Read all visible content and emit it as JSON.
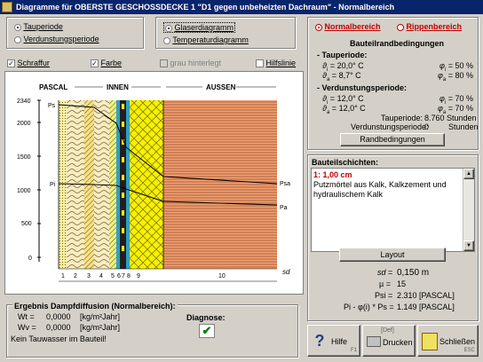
{
  "window": {
    "title": "Diagramme für OBERSTE GESCHOSSDECKE 1 \"D1 gegen unbeheizten Dachraum\" - Normalbereich"
  },
  "options": {
    "period_radio": [
      {
        "label": "Tauperiode",
        "checked": true
      },
      {
        "label": "Verdunstungsperiode",
        "checked": false
      }
    ],
    "diagram_radio": [
      {
        "label": "Glaserdiagramm",
        "checked": true
      },
      {
        "label": "Temperaturdiagramm",
        "checked": false
      }
    ],
    "checkboxes": [
      {
        "label": "Schraffur",
        "checked": true,
        "enabled": true
      },
      {
        "label": "Farbe",
        "checked": true,
        "enabled": true
      },
      {
        "label": "grau hinterlegt",
        "checked": false,
        "enabled": false
      },
      {
        "label": "Hilfslinie",
        "checked": false,
        "enabled": true
      }
    ]
  },
  "diagram": {
    "y_unit": "PASCAL",
    "y_ticks": [
      "2340",
      "2000",
      "1500",
      "1000",
      "500",
      "0"
    ],
    "inside_label": "INNEN",
    "outside_label": "AUSSEN",
    "x_label": "sd",
    "layer_numbers": [
      "1",
      "2",
      "3",
      "4",
      "5",
      "6",
      "7",
      "8",
      "9",
      "10"
    ],
    "curve_labels": {
      "ps_left": "Ps",
      "pi_left": "Pi",
      "psa_right": "Psa",
      "pa_right": "Pa"
    }
  },
  "right_top": {
    "mode_radio": [
      {
        "label": "Normalbereich",
        "checked": true
      },
      {
        "label": "Rippenbereich",
        "checked": false
      }
    ],
    "heading": "Bauteilrandbedingungen",
    "tau_heading": "- Tauperiode:",
    "tau": {
      "ti": "20,0° C",
      "ta": "8,7° C",
      "phi_i": "50 %",
      "phi_a": "80 %"
    },
    "verd_heading": "- Verdunstungsperiode:",
    "verd": {
      "ti": "12,0° C",
      "ta": "12,0° C",
      "phi_i": "70 %",
      "phi_a": "70 %"
    },
    "tauperiode_label": "Tauperiode:",
    "tauperiode_value": "8.760 Stunden",
    "verd_label": "Verdunstungsperiode:",
    "verd_value": "0",
    "verd_unit": "Stunden",
    "rand_button": "Randbedingungen"
  },
  "layers": {
    "heading": "Bauteilschichten:",
    "selected_title": "1: 1,00 cm",
    "selected_desc": "Putzmörtel aus Kalk, Kalkzement und hydraulischem Kalk",
    "layout_button": "Layout",
    "sd_label": "sd",
    "sd_value": "0,150 m",
    "mu_label": "µ",
    "mu_value": "15",
    "psi_label": "Psi",
    "psi_value": "2.310 [PASCAL]",
    "formula_label": "Pi - φ(i) * Ps",
    "formula_value": "1.149 [PASCAL]"
  },
  "result": {
    "heading": "Ergebnis Dampfdiffusion (Normalbereich):",
    "wt_label": "Wt",
    "wt_value": "0,0000",
    "wt_unit": "[kg/m²Jahr]",
    "wv_label": "Wv",
    "wv_value": "0,0000",
    "wv_unit": "[kg/m²Jahr]",
    "message": "Kein Tauwasser im Bauteil!",
    "diagnose_label": "Diagnose:",
    "diagnose_mark": "✔"
  },
  "buttons": {
    "hilfe": "Hilfe",
    "hilfe_key": "F1",
    "drucken": "Drucken",
    "drucken_key": "[Def]",
    "schliessen": "Schließen",
    "schliessen_key": "ESC"
  },
  "colors": {
    "title_bg": "#08246b",
    "accent_red": "#c00000",
    "layer_blue": "#30a0c0",
    "insulation_yellow": "#f8f000",
    "outside_orange": "#f0a070",
    "check_green": "#008000"
  }
}
